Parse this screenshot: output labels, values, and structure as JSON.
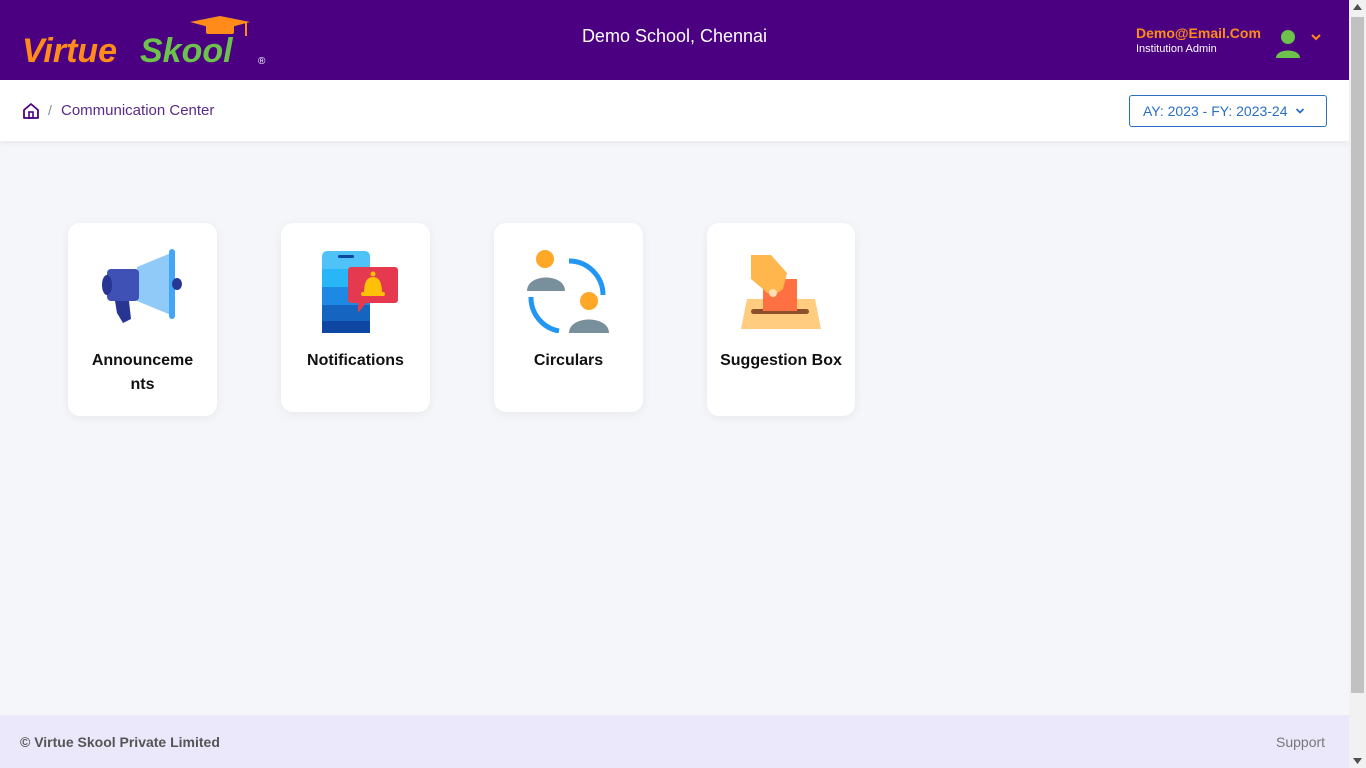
{
  "header": {
    "logo_text_virtue": "Virtue",
    "logo_text_skool": "Skool",
    "logo_reg_mark": "®",
    "school_name": "Demo School, Chennai",
    "user_email": "Demo@Email.Com",
    "user_role": "Institution Admin"
  },
  "breadcrumb": {
    "separator": "/",
    "current": "Communication Center"
  },
  "year_selector": {
    "value": "AY: 2023 - FY: 2023-24"
  },
  "cards": [
    {
      "label": "Announceme nts",
      "icon": "megaphone-icon"
    },
    {
      "label": "Notifications",
      "icon": "phone-notification-icon"
    },
    {
      "label": "Circulars",
      "icon": "users-exchange-icon"
    },
    {
      "label": "Suggestion Box",
      "icon": "ballot-box-icon"
    }
  ],
  "footer": {
    "copyright": "© Virtue Skool Private Limited",
    "support": "Support"
  },
  "colors": {
    "header_bg": "#4b0082",
    "accent_orange": "#ff8c1a",
    "logo_green": "#6cc24a",
    "link_blue": "#2a6fc2",
    "footer_bg": "#ebe8fb"
  }
}
